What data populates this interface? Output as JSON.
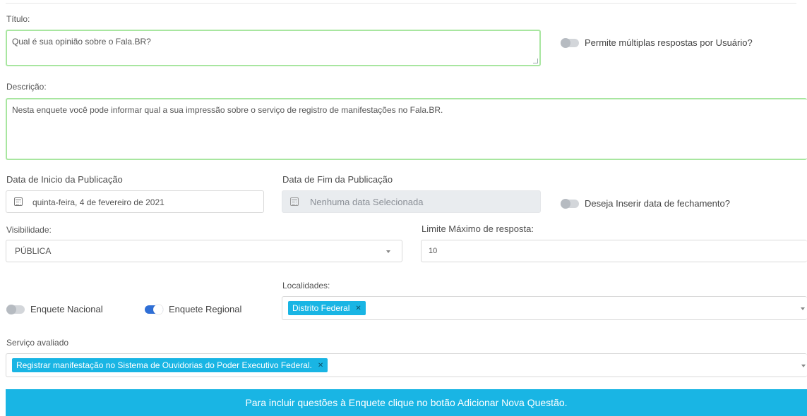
{
  "titulo": {
    "label": "Título:",
    "value": "Qual é sua opinião sobre o Fala.BR?"
  },
  "multiplas": {
    "label": "Permite múltiplas respostas por Usuário?",
    "on": false
  },
  "descricao": {
    "label": "Descrição:",
    "value": "Nesta enquete você pode informar qual a sua impressão sobre o serviço de registro de manifestações no Fala.BR."
  },
  "inicio": {
    "label": "Data de Inicio da Publicação",
    "value": "quinta-feira, 4 de fevereiro de 2021",
    "icon": "calendar-icon"
  },
  "fim": {
    "label": "Data de Fim da Publicação",
    "placeholder": "Nenhuma data Selecionada",
    "icon": "calendar-icon"
  },
  "fechamento": {
    "label": "Deseja Inserir data de fechamento?",
    "on": false
  },
  "visibilidade": {
    "label": "Visibilidade:",
    "value": "PÚBLICA"
  },
  "limite": {
    "label": "Limite Máximo de resposta:",
    "value": "10"
  },
  "nacional": {
    "label": "Enquete Nacional",
    "on": false
  },
  "regional": {
    "label": "Enquete Regional",
    "on": true
  },
  "localidades": {
    "label": "Localidades:",
    "chips": [
      "Distrito Federal"
    ]
  },
  "servico": {
    "label": "Serviço avaliado",
    "chips": [
      "Registrar manifestação no Sistema de Ouvidorias do Poder Executivo Federal."
    ]
  },
  "banner": {
    "text": "Para incluir questões à Enquete clique no botão Adicionar Nova Questão."
  },
  "colors": {
    "accent": "#19b5e4",
    "toggle_on": "#2f6fd6",
    "valid_border": "#a8e6a0"
  }
}
